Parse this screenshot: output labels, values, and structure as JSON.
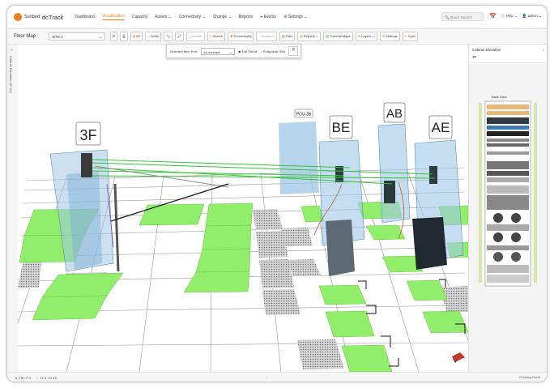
{
  "app": {
    "brand": "Sunbird",
    "product": "dcTrack"
  },
  "nav": {
    "items": [
      {
        "label": "Dashboard",
        "active": false
      },
      {
        "label": "Visualization",
        "active": true
      },
      {
        "label": "Capacity",
        "active": false
      },
      {
        "label": "Assets ⌄",
        "active": false
      },
      {
        "label": "Connectivity ⌄",
        "active": false
      },
      {
        "label": "Change ⌄",
        "active": false
      },
      {
        "label": "Reports",
        "active": false
      },
      {
        "label": "Events",
        "active": false
      },
      {
        "label": "Settings ⌄",
        "active": false
      }
    ],
    "quick_search_placeholder": "Quick Search",
    "help_label": "Help ⌄",
    "user_label": "admin ⌄"
  },
  "toolbar": {
    "title": "Floor Map",
    "site_select": "SITE A",
    "buttons": [
      {
        "label": "2D",
        "icon": "2d-icon",
        "disabled": false
      },
      {
        "label": "Home",
        "icon": "home-icon",
        "disabled": false
      },
      {
        "label": "",
        "icon": "zoom-in-icon",
        "disabled": false
      },
      {
        "label": "",
        "icon": "zoom-out-icon",
        "disabled": false
      },
      {
        "label": "Isolate",
        "icon": "isolate-icon",
        "disabled": true
      },
      {
        "label": "Search",
        "icon": "search-icon",
        "disabled": false
      },
      {
        "label": "Connectivity",
        "icon": "connectivity-icon",
        "disabled": false
      },
      {
        "label": "Measure",
        "icon": "measure-icon",
        "disabled": true
      },
      {
        "label": "Tiles",
        "icon": "tiles-icon",
        "disabled": false
      },
      {
        "label": "Reports ⌄",
        "icon": "reports-icon",
        "disabled": false
      },
      {
        "label": "Thermal Maps",
        "icon": "thermal-icon",
        "disabled": false
      },
      {
        "label": "Layers ⌄",
        "icon": "layers-icon",
        "disabled": false
      },
      {
        "label": "Settings",
        "icon": "settings-icon",
        "disabled": false
      },
      {
        "label": "Sync",
        "icon": "sync-icon",
        "disabled": false
      }
    ]
  },
  "popup": {
    "label": "Selected Item Port:",
    "select_value": "11 checked",
    "option_full": "Full Circuit",
    "option_endpoints": "Endpoints Only"
  },
  "left_strip": {
    "vertical_text": "Cabinet Elevation (3F-3C)"
  },
  "scene": {
    "labels": [
      "3F",
      "BE",
      "AB",
      "AE",
      "PDU-3B"
    ]
  },
  "right_panel": {
    "title": "Cabinet Elevation",
    "subtitle": "3F",
    "view_label": "Back View"
  },
  "status": {
    "tile": "Tile: P-9",
    "position": "11.9, 39.3 ft",
    "drawing": "Drawing North"
  },
  "colors": {
    "accent": "#ef7d1a",
    "tile_green": "#90ee6a",
    "rack_blue": "#9ec7e6"
  }
}
